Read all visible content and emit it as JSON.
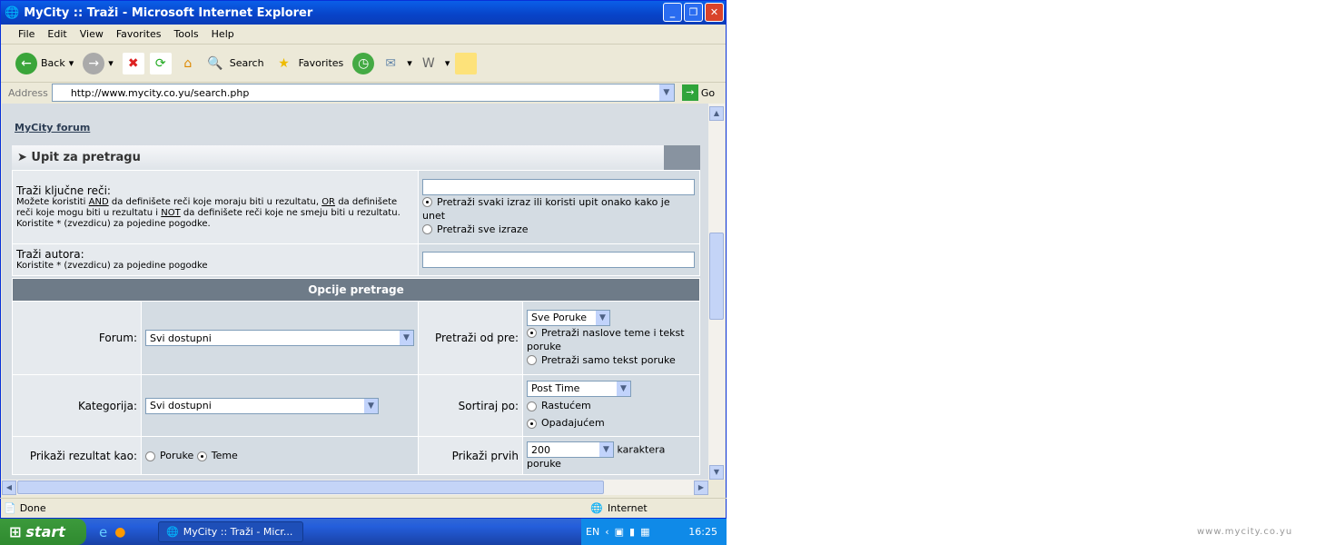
{
  "window": {
    "title": "MyCity :: Traži - Microsoft Internet Explorer"
  },
  "menu": [
    "File",
    "Edit",
    "View",
    "Favorites",
    "Tools",
    "Help"
  ],
  "toolbar": {
    "back": "Back",
    "search": "Search",
    "favorites": "Favorites"
  },
  "address": {
    "label": "Address",
    "url": "http://www.mycity.co.yu/search.php",
    "go": "Go"
  },
  "page": {
    "breadcrumb": "MyCity forum",
    "query_header": "Upit za pretragu",
    "keywords_label": "Traži ključne reči:",
    "keywords_help_1": "Možete koristiti ",
    "and": "AND",
    "keywords_help_2": " da definišete reči koje moraju biti u rezultatu, ",
    "or": "OR",
    "keywords_help_3": " da definišete reči koje mogu biti u rezultatu i ",
    "not": "NOT",
    "keywords_help_4": " da definišete reči koje ne smeju biti u rezultatu. Koristite * (zvezdicu) za pojedine pogodke.",
    "radio_any": "Pretraži svaki izraz ili koristi upit onako kako je unet",
    "radio_all": "Pretraži sve izraze",
    "author_label": "Traži autora:",
    "author_help": "Koristite * (zvezdicu) za pojedine pogodke",
    "options_header": "Opcije pretrage",
    "forum_label": "Forum:",
    "forum_value": "Svi dostupni",
    "since_label": "Pretraži od pre:",
    "since_value": "Sve Poruke",
    "radio_titles": "Pretraži naslove teme i tekst poruke",
    "radio_text": "Pretraži samo tekst poruke",
    "category_label": "Kategorija:",
    "category_value": "Svi dostupni",
    "sort_label": "Sortiraj po:",
    "sort_value": "Post Time",
    "asc": "Rastućem",
    "desc": "Opadajućem",
    "show_as_label": "Prikaži rezultat kao:",
    "show_posts": "Poruke",
    "show_topics": "Teme",
    "show_first_label": "Prikaži prvih",
    "show_first_value": "200",
    "show_first_suffix": "karaktera poruke"
  },
  "status": {
    "text": "Done",
    "zone": "Internet"
  },
  "taskbar": {
    "start": "start",
    "task": "MyCity :: Traži - Micr...",
    "lang": "EN",
    "time": "16:25"
  },
  "watermark": "www.mycity.co.yu"
}
